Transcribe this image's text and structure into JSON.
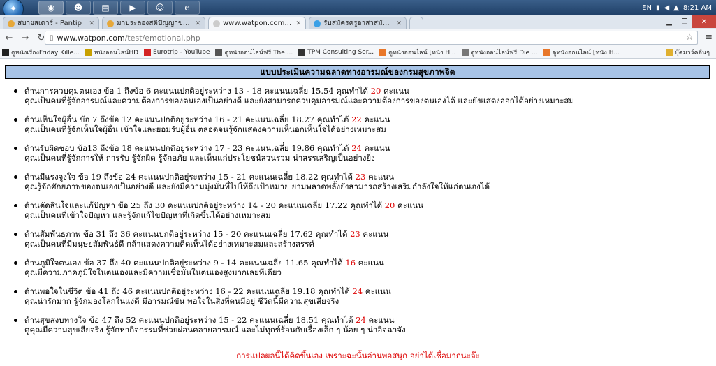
{
  "taskbar": {
    "apps": [
      "chrome",
      "security",
      "folder",
      "media",
      "chat",
      "ie"
    ],
    "lang": "EN",
    "clock": "8:21 AM"
  },
  "tabs": [
    {
      "label": "สบายสเดาร์ - Pantip",
      "color": "#e6a83a"
    },
    {
      "label": "มาประลองสติปัญญาของคุณกับ",
      "color": "#e6a83a"
    },
    {
      "label": "www.watpon.com/test/em",
      "color": "#ffffff"
    },
    {
      "label": "รับสมัครครูอาสาสมัคร จ.สมุทร",
      "color": "#3aa0e6"
    }
  ],
  "address": {
    "domain": "www.watpon.com",
    "path": "/test/emotional.php"
  },
  "bookmarks": [
    {
      "label": "ดูหนังเรื่องFriday Kille...",
      "color": "#222"
    },
    {
      "label": "หนังออนไลน์HD",
      "color": "#c8a000"
    },
    {
      "label": "Eurotrip - YouTube",
      "color": "#d32222"
    },
    {
      "label": "ดูหนังออนไลน์ฟรี The ...",
      "color": "#555"
    },
    {
      "label": "TPM Consulting Ser...",
      "color": "#333"
    },
    {
      "label": "ดูหนังออนไลน์ [หนัง H...",
      "color": "#e8772a"
    },
    {
      "label": "ดูหนังออนไลน์ฟรี Die ...",
      "color": "#777"
    },
    {
      "label": "ดูหนังออนไลน์ [หนัง H...",
      "color": "#e8772a"
    }
  ],
  "other_bookmarks": "บุ๊คมาร์คอื่นๆ",
  "page": {
    "title": "แบบประเมินความฉลาดทางอารมณ์ของกรมสุขภาพจิต",
    "results": [
      {
        "line1": "ด้านการควบคุมตนเอง ข้อ 1 ถึงข้อ 6 คะแนนปกติอยู่ระหว่าง 13 - 18 คะแนนเฉลี่ย 15.54 คุณทำได้",
        "score": "20",
        "unit": "คะแนน",
        "line2": "คุณเป็นคนที่รู้จักอารมณ์และความต้องการของตนเองเป็นอย่างดี และยังสามารถควบคุมอารมณ์และความต้องการของตนเองได้ และยังแสดงออกได้อย่างเหมาะสม"
      },
      {
        "line1": "ด้านเห็นใจผู้อื่น ข้อ 7 ถึงข้อ 12 คะแนนปกติอยู่ระหว่าง 16 - 21 คะแนนเฉลี่ย 18.27 คุณทำได้",
        "score": "22",
        "unit": "คะแนน",
        "line2": "คุณเป็นคนที่รู้จักเห็นใจผู้อื่น เข้าใจและยอมรับผู้อื่น ตลอดจนรู้จักแสดงความเห็นอกเห็นใจได้อย่างเหมาะสม"
      },
      {
        "line1": "ด้านรับผิดชอบ ข้อ13 ถึงข้อ 18 คะแนนปกติอยู่ระหว่าง 17 - 23 คะแนนเฉลี่ย 19.86 คุณทำได้",
        "score": "24",
        "unit": "คะแนน",
        "line2": "คุณเป็นคนที่รู้จักการให้ การรับ รู้จักผิด รู้จักอภัย และเห็นแก่ประโยชน์ส่วนรวม น่าสรรเสริญเป็นอย่างยิ่ง"
      },
      {
        "line1": "ด้านมีแรงจูงใจ ข้อ 19 ถึงข้อ 24 คะแนนปกติอยู่ระหว่าง 15 - 21 คะแนนเฉลี่ย 18.22 คุณทำได้",
        "score": "23",
        "unit": "คะแนน",
        "line2": "คุณรู้จักศักยภาพของตนเองเป็นอย่างดี และยังมีความมุ่งมั่นที่ไปให้ถึงเป้าหมาย ยามพลาดพลั้งยังสามารถสร้างเสริมกำลังใจให้แก่ตนเองได้"
      },
      {
        "line1": "ด้านตัดสินใจและแก้ปัญหา ข้อ 25 ถึง 30 คะแนนปกติอยู่ระหว่าง 14 - 20 คะแนนเฉลี่ย 17.22 คุณทำได้",
        "score": "20",
        "unit": "คะแนน",
        "line2": "คุณเป็นคนที่เข้าใจปัญหา และรู้จักแก้ไขปัญหาที่เกิดขึ้นได้อย่างเหมาะสม"
      },
      {
        "line1": "ด้านสัมพันธภาพ ข้อ 31 ถึง 36 คะแนนปกติอยู่ระหว่าง 15 - 20 คะแนนเฉลี่ย 17.62 คุณทำได้",
        "score": "23",
        "unit": "คะแนน",
        "line2": "คุณเป็นคนที่มีมนุษยสัมพันธ์ดี กล้าแสดงความคิดเห็นได้อย่างเหมาะสมและสร้างสรรค์"
      },
      {
        "line1": "ด้านภูมิใจตนเอง ข้อ 37 ถึง 40 คะแนนปกติอยู่ระหว่าง 9 - 14 คะแนนเฉลี่ย 11.65 คุณทำได้",
        "score": "16",
        "unit": "คะแนน",
        "line2": "คุณมีความภาคภูมิใจในตนเองและมีความเชื่อมั่นในตนเองสูงมากเลยทีเดียว"
      },
      {
        "line1": "ด้านพอใจในชีวิต ข้อ 41 ถึง 46 คะแนนปกติอยู่ระหว่าง 16 - 22 คะแนนเฉลี่ย 19.18 คุณทำได้",
        "score": "24",
        "unit": "คะแนน",
        "line2": "คุณน่ารักมาก รู้จักมองโลกในแง่ดี มีอารมณ์ขัน พอใจในสิ่งที่ตนมีอยู่ ชีวิตนี้มีความสุขเสียจริง"
      },
      {
        "line1": "ด้านสุขสงบทางใจ ข้อ 47 ถึง 52 คะแนนปกติอยู่ระหว่าง 15 - 22 คะแนนเฉลี่ย 18.51 คุณทำได้",
        "score": "24",
        "unit": "คะแนน",
        "line2": "ดูคุณมีความสุขเสียจริง รู้จักหากิจกรรมที่ช่วยผ่อนคลายอารมณ์ และไม่ทุกข์ร้อนกับเรื่องเล็ก ๆ น้อย ๆ น่าอิจฉาจัง"
      }
    ],
    "footer_note": "การแปลผลนี้ได้คิดขึ้นเอง เพราะฉะนั้นอ่านพอสนุก อย่าได้เชื่อมากนะจ๊ะ"
  }
}
